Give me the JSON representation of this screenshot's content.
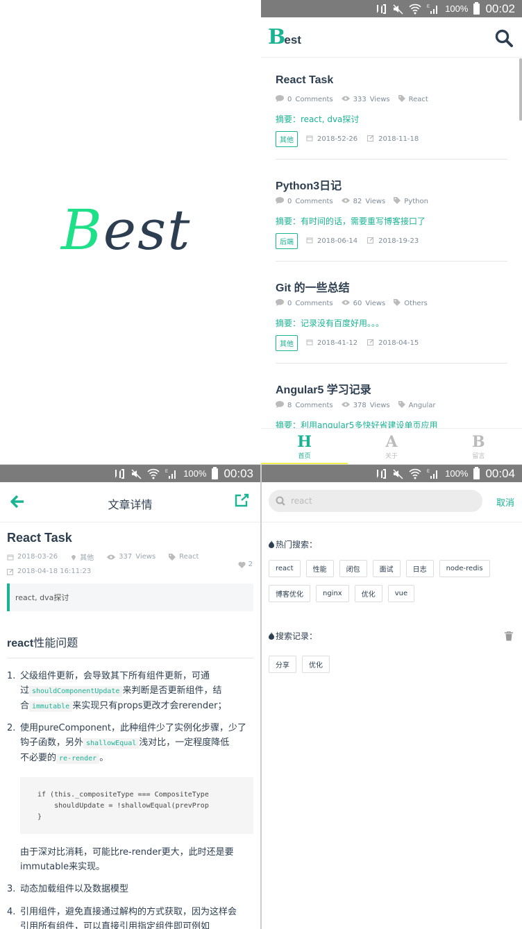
{
  "status_bars": [
    {
      "battery": "100%",
      "time": "00:02"
    },
    {
      "battery": "100%",
      "time": "00:03"
    },
    {
      "battery": "100%",
      "time": "00:04"
    }
  ],
  "splash": {
    "logo_first": "B",
    "logo_rest": "est"
  },
  "list_screen": {
    "logo_first": "B",
    "logo_rest": "est",
    "posts": [
      {
        "title": "React Task",
        "comments": "0",
        "comments_label": "Comments",
        "views": "333",
        "views_label": "Views",
        "category": "React",
        "summary": "摘要：react, dva探讨",
        "tag": "其他",
        "created": "2018-52-26",
        "updated": "2018-11-18"
      },
      {
        "title": "Python3日记",
        "comments": "0",
        "comments_label": "Comments",
        "views": "82",
        "views_label": "Views",
        "category": "Python",
        "summary": "摘要：有时间的话，需要重写博客接口了",
        "tag": "后端",
        "created": "2018-06-14",
        "updated": "2018-19-23"
      },
      {
        "title": "Git 的一些总结",
        "comments": "0",
        "comments_label": "Comments",
        "views": "60",
        "views_label": "Views",
        "category": "Others",
        "summary": "摘要：记录没有百度好用。。。",
        "tag": "其他",
        "created": "2018-41-12",
        "updated": "2018-04-15"
      },
      {
        "title": "Angular5 学习记录",
        "comments": "8",
        "comments_label": "Comments",
        "views": "378",
        "views_label": "Views",
        "category": "Angular",
        "summary": "摘要：利用angular5多快好省建设单页应用"
      }
    ],
    "tabs": [
      {
        "letter": "H",
        "label": "首页",
        "active": true
      },
      {
        "letter": "A",
        "label": "关于",
        "active": false
      },
      {
        "letter": "B",
        "label": "留言",
        "active": false
      }
    ]
  },
  "detail_screen": {
    "header_title": "文章详情",
    "title": "React Task",
    "created": "2018-03-26",
    "category": "其他",
    "views": "337",
    "views_label": "Views",
    "tag": "React",
    "updated": "2018-04-18 16:11:23",
    "likes": "2",
    "quote": "react, dva探讨",
    "heading_bold": "react",
    "heading_rest": "性能问题",
    "items": {
      "i1_num": "1.",
      "i1_a": "父级组件更新，会导致其下所有组件更新，可通",
      "i1_b": "过",
      "i1_code1": "shouldComponentUpdate",
      "i1_c": "来判断是否更新组件，结",
      "i1_d": "合",
      "i1_code2": "immutable",
      "i1_e": "来实现只有props更改才会rerender；",
      "i2_num": "2.",
      "i2_a": "使用pureComponent，此种组件少了实例化步骤，少了",
      "i2_b": "钩子函数，另外",
      "i2_code1": "shallowEqual",
      "i2_c": "浅对比，一定程度降低",
      "i2_d": "不必要的",
      "i2_code2": "re-render",
      "i2_e": "。",
      "code_block": "if (this._compositeType === CompositeType\n    shouldUpdate = !shallowEqual(prevProp\n}",
      "para": "由于深对比消耗，可能比re-render更大，此时还是要",
      "para2": "immutable来实现。",
      "i3_num": "3.",
      "i3": "动态加载组件以及数据模型",
      "i4_num": "4.",
      "i4_a": "引用组件，避免直接通过解构的方式获取，因为这样会",
      "i4_b": "引用所有组件，可以直接引用指定组件即可例如"
    }
  },
  "search_screen": {
    "placeholder": "react",
    "cancel": "取消",
    "hot_title": "热门搜索：",
    "hot": [
      "react",
      "性能",
      "闭包",
      "面试",
      "日志",
      "node-redis",
      "博客优化",
      "nginx",
      "优化",
      "vue"
    ],
    "history_title": "搜索记录：",
    "history": [
      "分享",
      "优化"
    ]
  },
  "colors": {
    "accent": "#1ab394",
    "logo_green": "#1ee089",
    "text": "#2c3e50",
    "status_bar": "#7b7b7b"
  }
}
